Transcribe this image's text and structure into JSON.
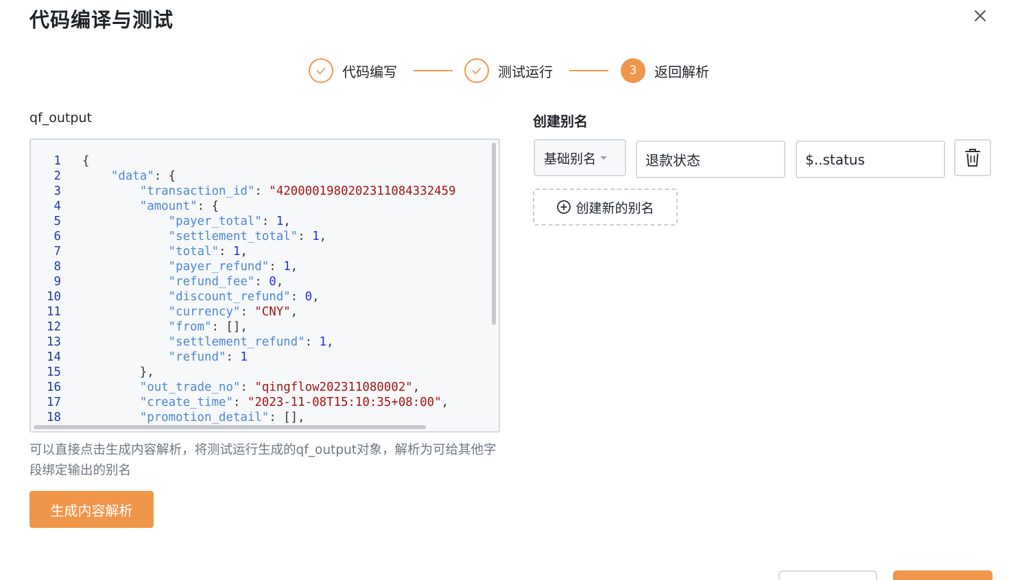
{
  "modal": {
    "title": "代码编译与测试"
  },
  "steps": [
    {
      "label": "代码编写",
      "status": "done"
    },
    {
      "label": "测试运行",
      "status": "done"
    },
    {
      "label": "返回解析",
      "status": "active",
      "number": "3"
    }
  ],
  "left": {
    "label": "qf_output",
    "hint": "可以直接点击生成内容解析，将测试运行生成的qf_output对象，解析为可给其他字段绑定输出的别名",
    "generate_button": "生成内容解析"
  },
  "code": {
    "lines": [
      {
        "n": "1",
        "tokens": [
          [
            "p",
            "{"
          ]
        ]
      },
      {
        "n": "2",
        "tokens": [
          [
            "p",
            "    "
          ],
          [
            "key",
            "\"data\""
          ],
          [
            "p",
            ": {"
          ]
        ]
      },
      {
        "n": "3",
        "tokens": [
          [
            "p",
            "        "
          ],
          [
            "key",
            "\"transaction_id\""
          ],
          [
            "p",
            ": "
          ],
          [
            "str",
            "\"4200001980202311084332459"
          ]
        ]
      },
      {
        "n": "4",
        "tokens": [
          [
            "p",
            "        "
          ],
          [
            "key",
            "\"amount\""
          ],
          [
            "p",
            ": {"
          ]
        ]
      },
      {
        "n": "5",
        "tokens": [
          [
            "p",
            "            "
          ],
          [
            "key",
            "\"payer_total\""
          ],
          [
            "p",
            ": "
          ],
          [
            "num",
            "1"
          ],
          [
            "p",
            ","
          ]
        ]
      },
      {
        "n": "6",
        "tokens": [
          [
            "p",
            "            "
          ],
          [
            "key",
            "\"settlement_total\""
          ],
          [
            "p",
            ": "
          ],
          [
            "num",
            "1"
          ],
          [
            "p",
            ","
          ]
        ]
      },
      {
        "n": "7",
        "tokens": [
          [
            "p",
            "            "
          ],
          [
            "key",
            "\"total\""
          ],
          [
            "p",
            ": "
          ],
          [
            "num",
            "1"
          ],
          [
            "p",
            ","
          ]
        ]
      },
      {
        "n": "8",
        "tokens": [
          [
            "p",
            "            "
          ],
          [
            "key",
            "\"payer_refund\""
          ],
          [
            "p",
            ": "
          ],
          [
            "num",
            "1"
          ],
          [
            "p",
            ","
          ]
        ]
      },
      {
        "n": "9",
        "tokens": [
          [
            "p",
            "            "
          ],
          [
            "key",
            "\"refund_fee\""
          ],
          [
            "p",
            ": "
          ],
          [
            "num",
            "0"
          ],
          [
            "p",
            ","
          ]
        ]
      },
      {
        "n": "10",
        "tokens": [
          [
            "p",
            "            "
          ],
          [
            "key",
            "\"discount_refund\""
          ],
          [
            "p",
            ": "
          ],
          [
            "num",
            "0"
          ],
          [
            "p",
            ","
          ]
        ]
      },
      {
        "n": "11",
        "tokens": [
          [
            "p",
            "            "
          ],
          [
            "key",
            "\"currency\""
          ],
          [
            "p",
            ": "
          ],
          [
            "str",
            "\"CNY\""
          ],
          [
            "p",
            ","
          ]
        ]
      },
      {
        "n": "12",
        "tokens": [
          [
            "p",
            "            "
          ],
          [
            "key",
            "\"from\""
          ],
          [
            "p",
            ": [],"
          ]
        ]
      },
      {
        "n": "13",
        "tokens": [
          [
            "p",
            "            "
          ],
          [
            "key",
            "\"settlement_refund\""
          ],
          [
            "p",
            ": "
          ],
          [
            "num",
            "1"
          ],
          [
            "p",
            ","
          ]
        ]
      },
      {
        "n": "14",
        "tokens": [
          [
            "p",
            "            "
          ],
          [
            "key",
            "\"refund\""
          ],
          [
            "p",
            ": "
          ],
          [
            "num",
            "1"
          ]
        ]
      },
      {
        "n": "15",
        "tokens": [
          [
            "p",
            "        },"
          ]
        ]
      },
      {
        "n": "16",
        "tokens": [
          [
            "p",
            "        "
          ],
          [
            "key",
            "\"out_trade_no\""
          ],
          [
            "p",
            ": "
          ],
          [
            "str",
            "\"qingflow202311080002\""
          ],
          [
            "p",
            ","
          ]
        ]
      },
      {
        "n": "17",
        "tokens": [
          [
            "p",
            "        "
          ],
          [
            "key",
            "\"create_time\""
          ],
          [
            "p",
            ": "
          ],
          [
            "str",
            "\"2023-11-08T15:10:35+08:00\""
          ],
          [
            "p",
            ","
          ]
        ]
      },
      {
        "n": "18",
        "tokens": [
          [
            "p",
            "        "
          ],
          [
            "key",
            "\"promotion_detail\""
          ],
          [
            "p",
            ": [],"
          ]
        ]
      }
    ]
  },
  "right": {
    "title": "创建别名",
    "alias_row": {
      "type_select": "基础别名",
      "alias_value": "退款状态",
      "path_value": "$..status"
    },
    "create_button": "创建新的别名"
  },
  "colors": {
    "accent": "#f0964a",
    "border": "#d5d9e0",
    "code_bg": "#f7f8fa",
    "key": "#4a88d6",
    "string": "#a31515",
    "number": "#1d2ee5"
  }
}
